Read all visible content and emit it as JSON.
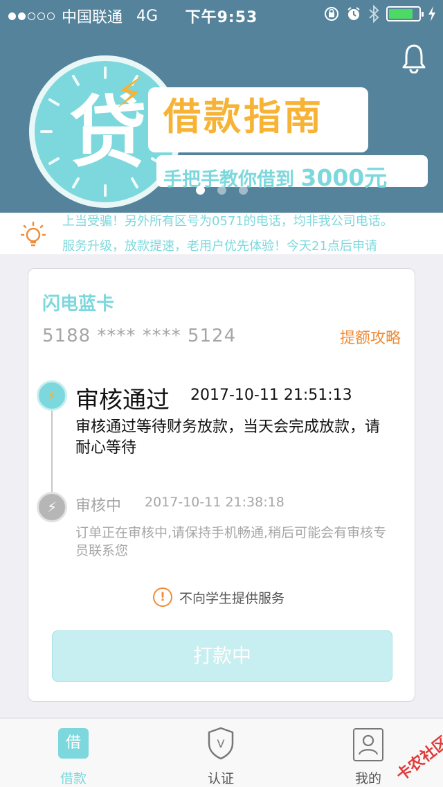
{
  "status_bar": {
    "carrier": "中国联通",
    "network": "4G",
    "time": "下午9:53"
  },
  "banner": {
    "big_char": "贷",
    "title": "借款指南",
    "subtitle_prefix": "手把手教你借到",
    "subtitle_amount": "3000元",
    "page_count": 3,
    "active_page": 1
  },
  "notice": {
    "line1": "上当受骗！另外所有区号为0571的电话，均非我公司电话。",
    "line2": "服务升级，放款提速，老用户优先体验！今天21点后申请"
  },
  "card": {
    "name": "闪电蓝卡",
    "number": "5188 **** **** 5124",
    "limit_link": "提额攻略"
  },
  "timeline": [
    {
      "title": "审核通过",
      "time": "2017-10-11 21:51:13",
      "desc": "审核通过等待财务放款，当天会完成放款，请耐心等待",
      "status": "done"
    },
    {
      "title": "审核中",
      "time": "2017-10-11 21:38:18",
      "desc": "订单正在审核中,请保持手机畅通,稍后可能会有审核专员联系您",
      "status": "past"
    }
  ],
  "warning": {
    "text": "不向学生提供服务"
  },
  "action_button": {
    "label": "打款中"
  },
  "tabs": [
    {
      "label": "借款",
      "icon_text": "借",
      "active": true
    },
    {
      "label": "认证",
      "icon_text": "V",
      "active": false
    },
    {
      "label": "我的",
      "active": false
    }
  ],
  "watermark": "卡农社区",
  "colors": {
    "header": "#54839b",
    "accent": "#7dd8dd",
    "orange": "#f08c37",
    "button_disabled": "#c7eef0"
  }
}
